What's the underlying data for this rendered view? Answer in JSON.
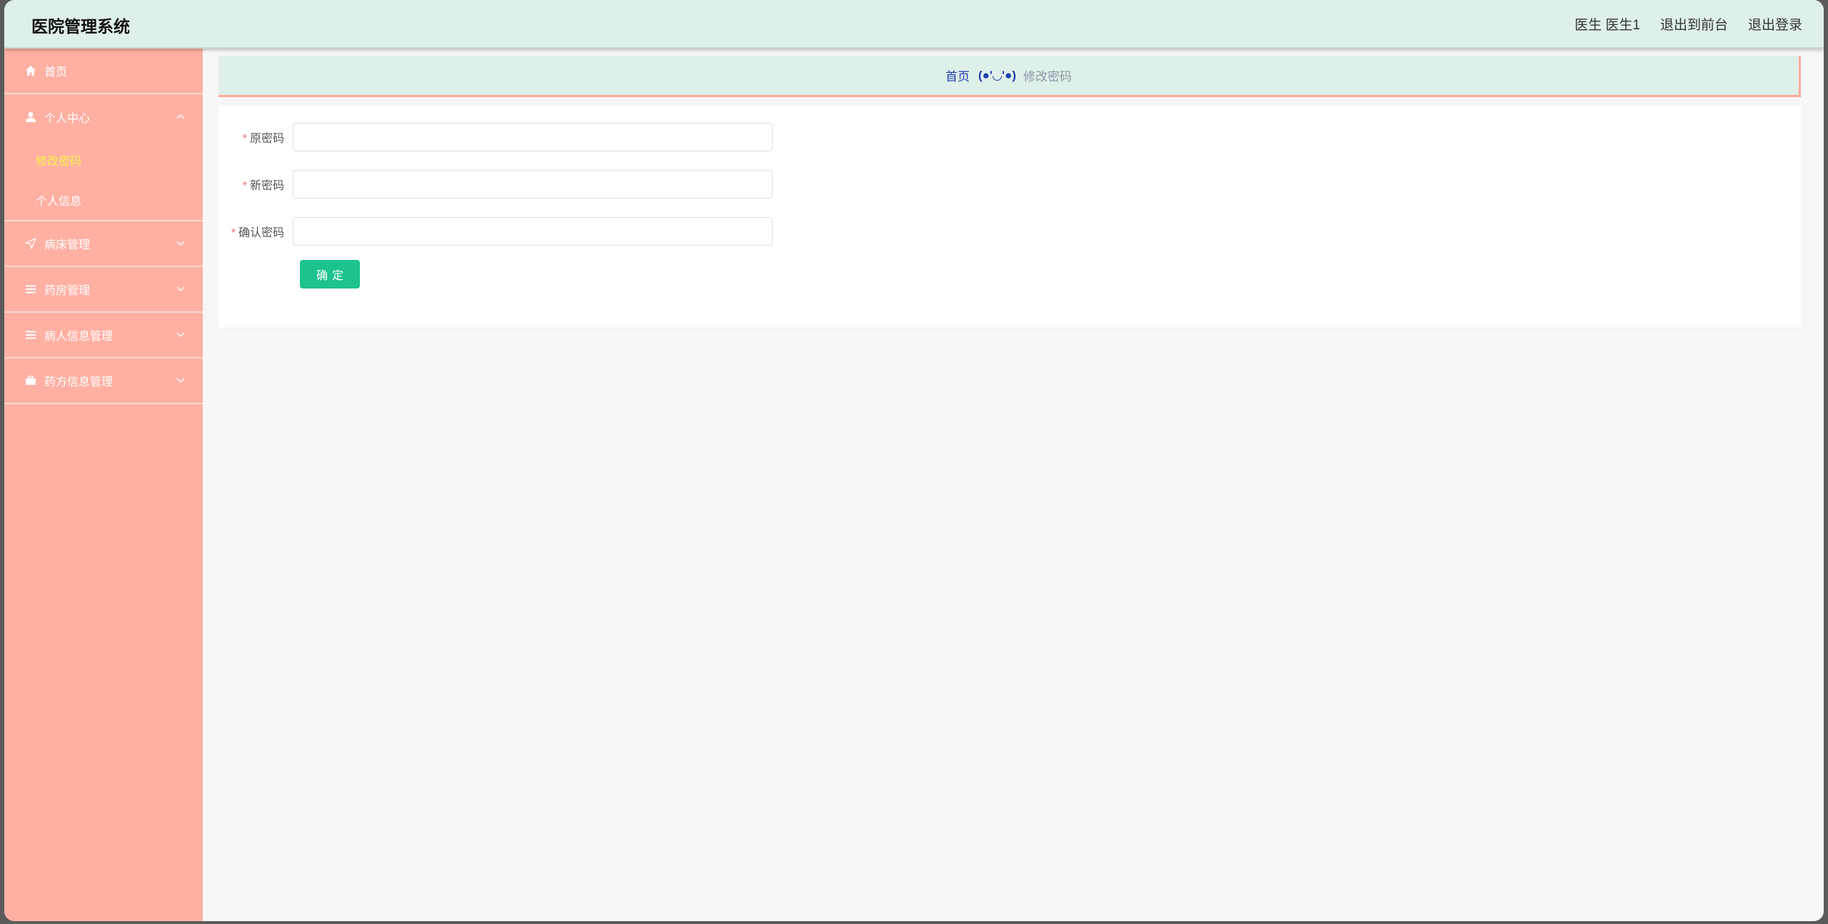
{
  "app": {
    "title": "医院管理系统"
  },
  "header": {
    "user_label": "医生 医生1",
    "to_front": "退出到前台",
    "logout": "退出登录"
  },
  "sidebar": {
    "items": [
      {
        "label": "首页",
        "icon": "home-icon"
      },
      {
        "label": "个人中心",
        "icon": "user-icon",
        "expanded": true,
        "children": [
          {
            "label": "修改密码",
            "active": true
          },
          {
            "label": "个人信息",
            "active": false
          }
        ]
      },
      {
        "label": "病床管理",
        "icon": "location-arrow-icon"
      },
      {
        "label": "药房管理",
        "icon": "list-icon"
      },
      {
        "label": "病人信息管理",
        "icon": "list-icon"
      },
      {
        "label": "药方信息管理",
        "icon": "briefcase-icon"
      }
    ]
  },
  "breadcrumb": {
    "home": "首页",
    "face": "(●'◡'●)",
    "current": "修改密码"
  },
  "form": {
    "fields": [
      {
        "label": "原密码",
        "value": "",
        "placeholder": ""
      },
      {
        "label": "新密码",
        "value": "",
        "placeholder": ""
      },
      {
        "label": "确认密码",
        "value": "",
        "placeholder": ""
      }
    ],
    "submit_label": "确定"
  },
  "colors": {
    "sidebar_bg": "#ffb0a3",
    "header_bg": "#dfefe9",
    "active_text": "#f7f34a",
    "button": "#1cc38e",
    "breadcrumb_home": "#1f3fae"
  }
}
